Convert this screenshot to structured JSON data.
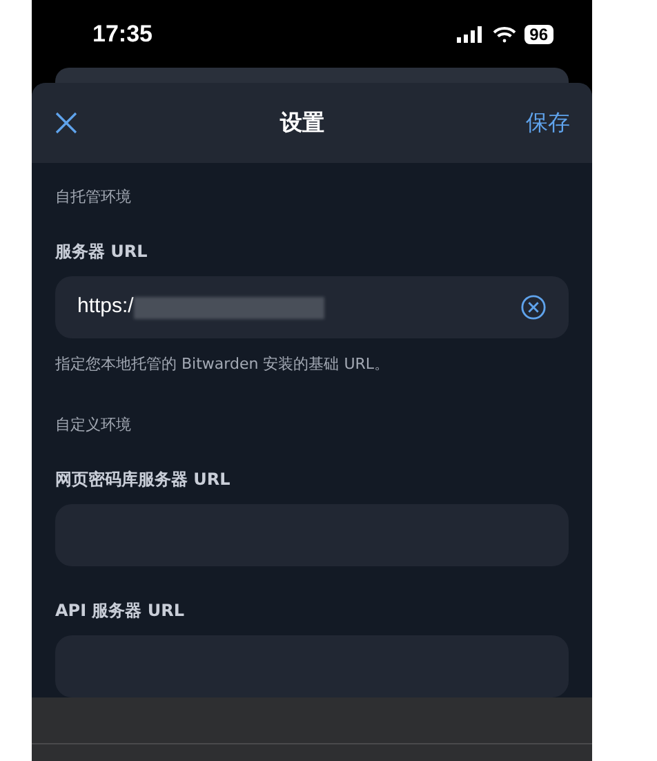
{
  "status_bar": {
    "time": "17:35",
    "battery": "96"
  },
  "header": {
    "title": "设置",
    "save": "保存"
  },
  "sections": [
    {
      "heading": "自托管环境",
      "fields": [
        {
          "label": "服务器 URL",
          "value": "https:/",
          "redacted": true,
          "clearable": true,
          "help": "指定您本地托管的 Bitwarden 安装的基础 URL。"
        }
      ]
    },
    {
      "heading": "自定义环境",
      "fields": [
        {
          "label": "网页密码库服务器 URL",
          "redacted": false,
          "clearable": false
        },
        {
          "label": "API 服务器 URL",
          "redacted": false,
          "clearable": false
        }
      ]
    }
  ]
}
